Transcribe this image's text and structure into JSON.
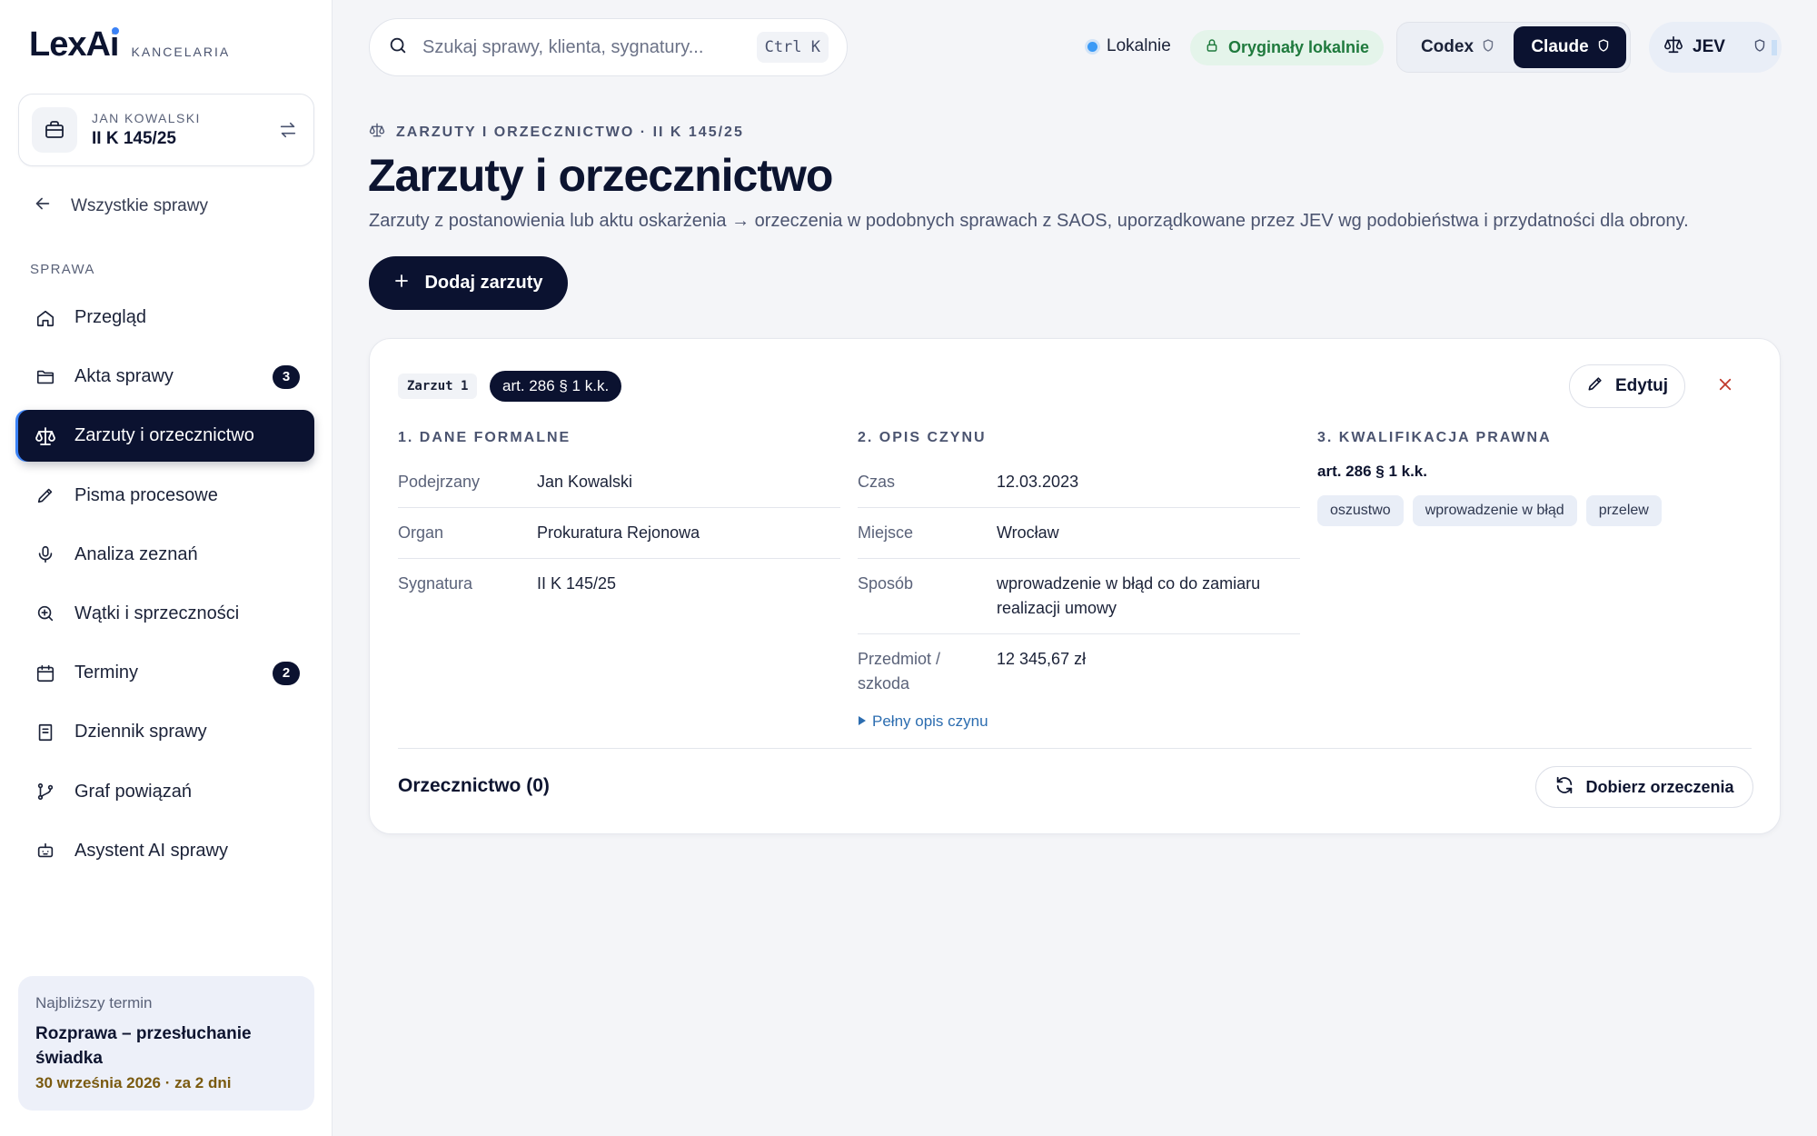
{
  "brand": {
    "name": "LexAi",
    "subtitle": "KANCELARIA"
  },
  "case": {
    "client": "JAN KOWALSKI",
    "number": "II K 145/25"
  },
  "sidebar": {
    "back_label": "Wszystkie sprawy",
    "section_label": "SPRAWA",
    "items": [
      {
        "label": "Przegląd",
        "icon": "home-icon"
      },
      {
        "label": "Akta sprawy",
        "icon": "folder-icon",
        "badge": "3"
      },
      {
        "label": "Zarzuty i orzecznictwo",
        "icon": "scale-icon",
        "active": true
      },
      {
        "label": "Pisma procesowe",
        "icon": "pencil-icon"
      },
      {
        "label": "Analiza zeznań",
        "icon": "microphone-icon"
      },
      {
        "label": "Wątki i sprzeczności",
        "icon": "search-plus-icon"
      },
      {
        "label": "Terminy",
        "icon": "calendar-icon",
        "badge": "2"
      },
      {
        "label": "Dziennik sprawy",
        "icon": "notebook-icon"
      },
      {
        "label": "Graf powiązań",
        "icon": "graph-icon"
      },
      {
        "label": "Asystent AI sprawy",
        "icon": "bot-icon"
      }
    ],
    "deadline": {
      "label": "Najbliższy termin",
      "title": "Rozprawa – przesłuchanie świadka",
      "date": "30 września 2026 · za 2 dni"
    }
  },
  "topbar": {
    "search_placeholder": "Szukaj sprawy, klienta, sygnatury...",
    "search_shortcut": "Ctrl K",
    "status_local": "Lokalnie",
    "originals_local": "Oryginały lokalnie",
    "models": [
      {
        "label": "Codex",
        "active": false
      },
      {
        "label": "Claude",
        "active": true
      }
    ],
    "jev_label": "JEV"
  },
  "header": {
    "breadcrumb": "ZARZUTY I ORZECZNICTWO · II K 145/25",
    "title": "Zarzuty i orzecznictwo",
    "description": "Zarzuty z postanowienia lub aktu oskarżenia → orzeczenia w podobnych sprawach z SAOS, uporządkowane przez JEV wg podobieństwa i przydatności dla obrony.",
    "add_button": "Dodaj zarzuty"
  },
  "charge": {
    "tag": "Zarzut 1",
    "article": "art. 286 § 1 k.k.",
    "edit_label": "Edytuj",
    "formal": {
      "title": "1. DANE FORMALNE",
      "rows": [
        {
          "k": "Podejrzany",
          "v": "Jan Kowalski"
        },
        {
          "k": "Organ",
          "v": "Prokuratura Rejonowa"
        },
        {
          "k": "Sygnatura",
          "v": "II K 145/25"
        }
      ]
    },
    "act": {
      "title": "2. OPIS CZYNU",
      "rows": [
        {
          "k": "Czas",
          "v": "12.03.2023"
        },
        {
          "k": "Miejsce",
          "v": "Wrocław"
        },
        {
          "k": "Sposób",
          "v": "wprowadzenie w błąd co do zamiaru realizacji umowy"
        },
        {
          "k": "Przedmiot / szkoda",
          "v": "12 345,67 zł"
        }
      ],
      "full_desc": "Pełny opis czynu"
    },
    "qualification": {
      "title": "3. KWALIFIKACJA PRAWNA",
      "article": "art. 286 § 1 k.k.",
      "chips": [
        "oszustwo",
        "wprowadzenie w błąd",
        "przelew"
      ]
    },
    "rulings_title": "Orzecznictwo (0)",
    "match_button": "Dobierz orzeczenia"
  },
  "colors": {
    "navy": "#0b1230",
    "accent_blue": "#3b82f6",
    "green_text": "#1f7a3d",
    "danger": "#c0392b",
    "deadline_date": "#7a5a10"
  }
}
